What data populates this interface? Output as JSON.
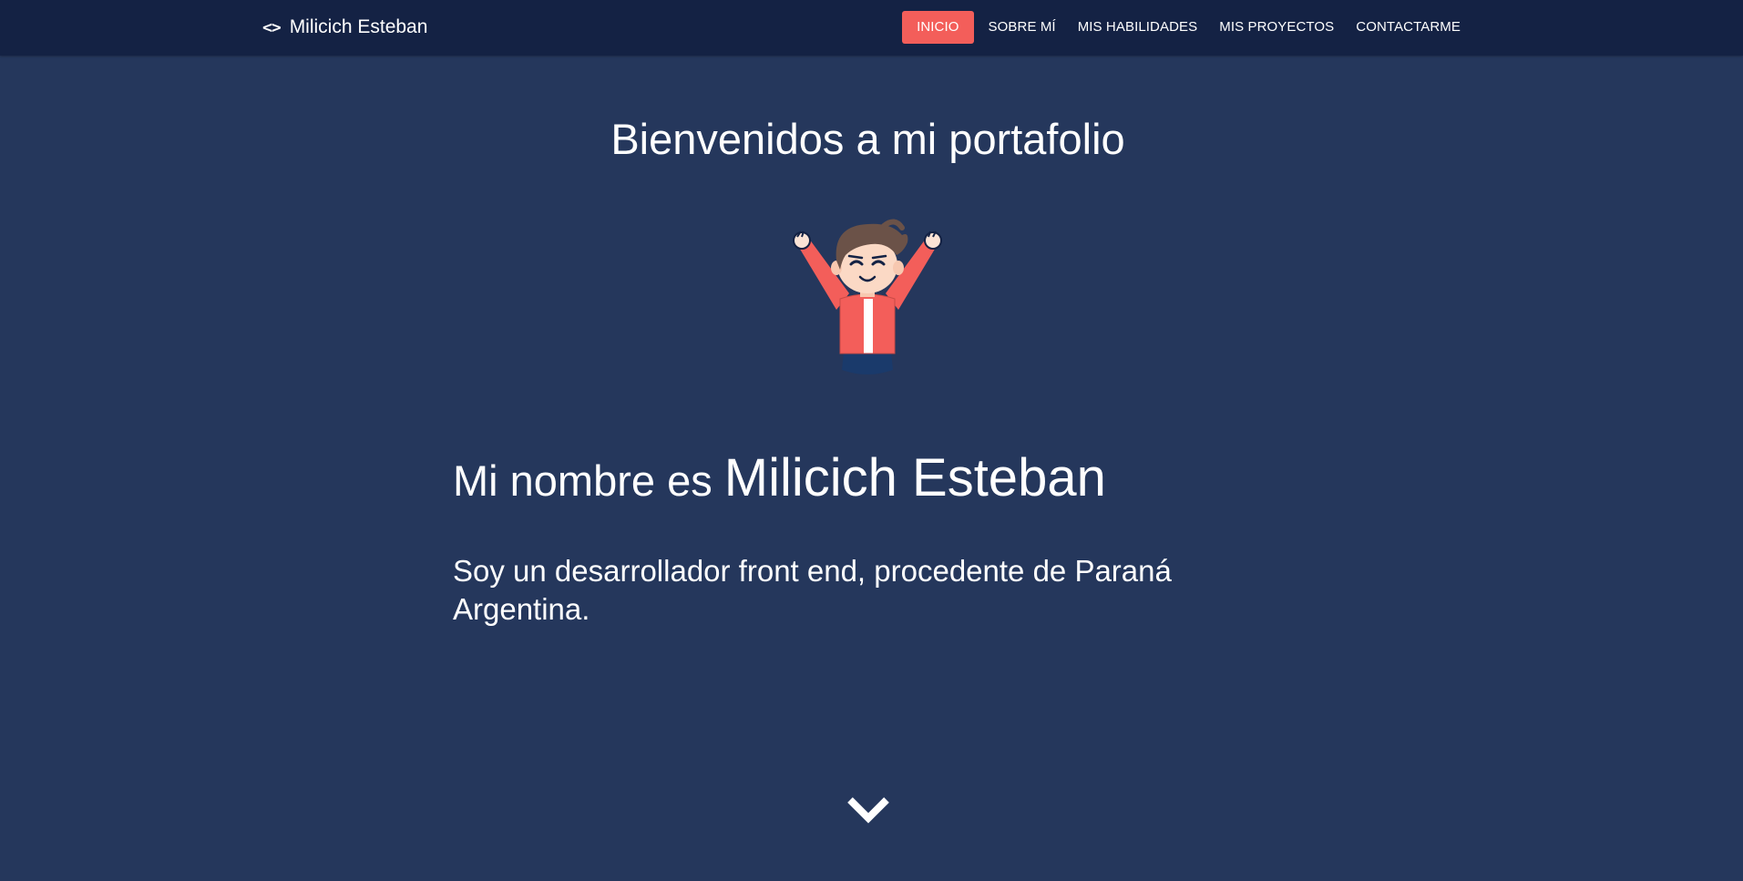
{
  "navbar": {
    "brand_icon": "<>",
    "brand_name": "Milicich Esteban",
    "links": [
      {
        "label": "INICIO",
        "active": true
      },
      {
        "label": "SOBRE MÍ",
        "active": false
      },
      {
        "label": "MIS HABILIDADES",
        "active": false
      },
      {
        "label": "MIS PROYECTOS",
        "active": false
      },
      {
        "label": "CONTACTARME",
        "active": false
      }
    ]
  },
  "hero": {
    "title": "Bienvenidos a mi portafolio",
    "intro_prefix": "Mi nombre es ",
    "intro_name": "Milicich Esteban",
    "description": "Soy un desarrollador front end, procedente de Paraná Argentina.",
    "avatar_icon": "cheering-man-avatar",
    "scroll_icon": "chevron-down-icon"
  },
  "colors": {
    "background": "#25375c",
    "navbar": "#142244",
    "accent": "#f35e5a",
    "text": "#ffffff"
  }
}
